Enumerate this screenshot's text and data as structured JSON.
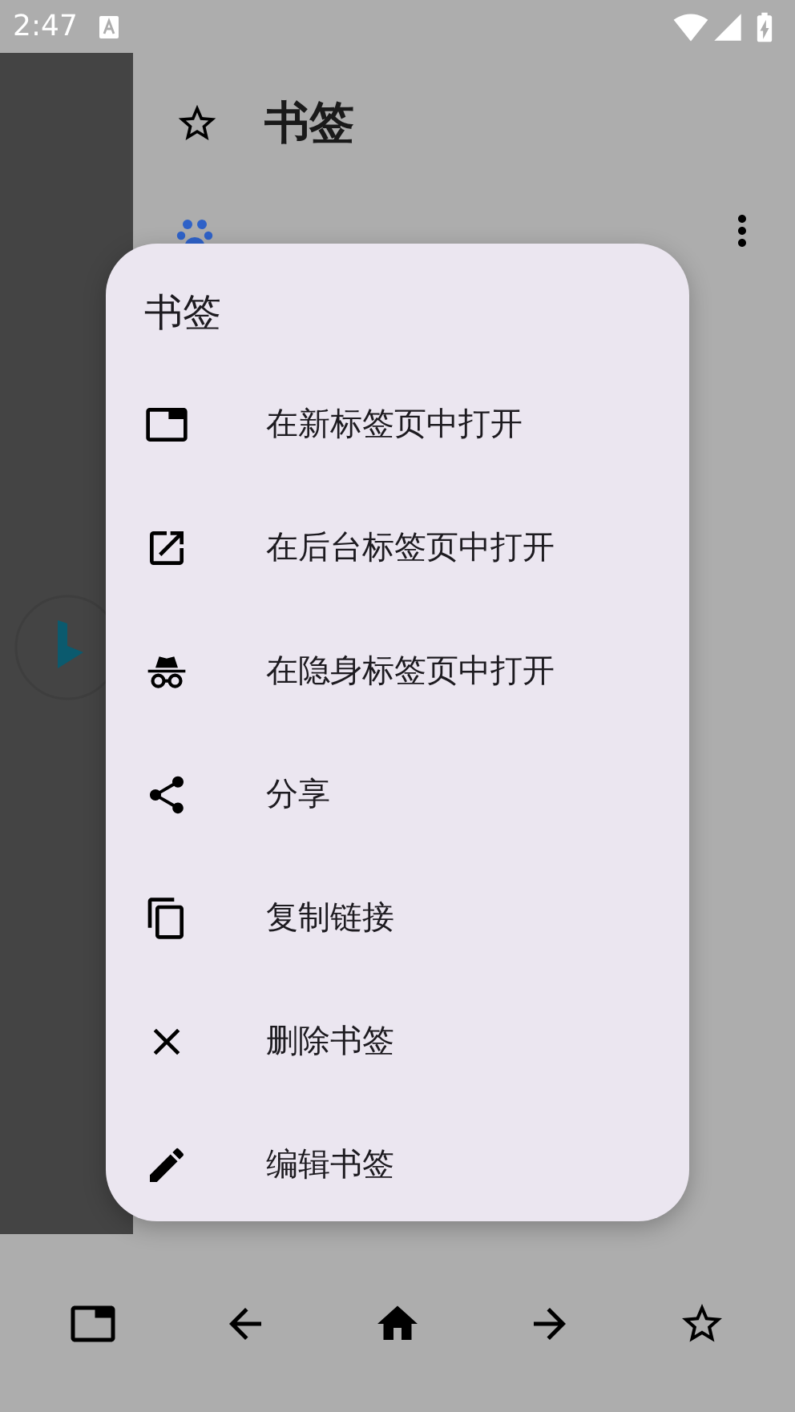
{
  "status_bar": {
    "time": "2:47"
  },
  "panel": {
    "title": "书签",
    "bookmarks": [
      {
        "kind": "site"
      }
    ]
  },
  "menu": {
    "title": "书签",
    "items": [
      {
        "kind": "tab",
        "label": "在新标签页中打开"
      },
      {
        "kind": "background",
        "label": "在后台标签页中打开"
      },
      {
        "kind": "incognito",
        "label": "在隐身标签页中打开"
      },
      {
        "kind": "share",
        "label": "分享"
      },
      {
        "kind": "copy",
        "label": "复制链接"
      },
      {
        "kind": "delete",
        "label": "删除书签"
      },
      {
        "kind": "edit",
        "label": "编辑书签"
      }
    ]
  },
  "bottom_bar": {
    "buttons": [
      {
        "kind": "tabs"
      },
      {
        "kind": "back"
      },
      {
        "kind": "home"
      },
      {
        "kind": "forward"
      },
      {
        "kind": "bookmarks"
      }
    ]
  }
}
